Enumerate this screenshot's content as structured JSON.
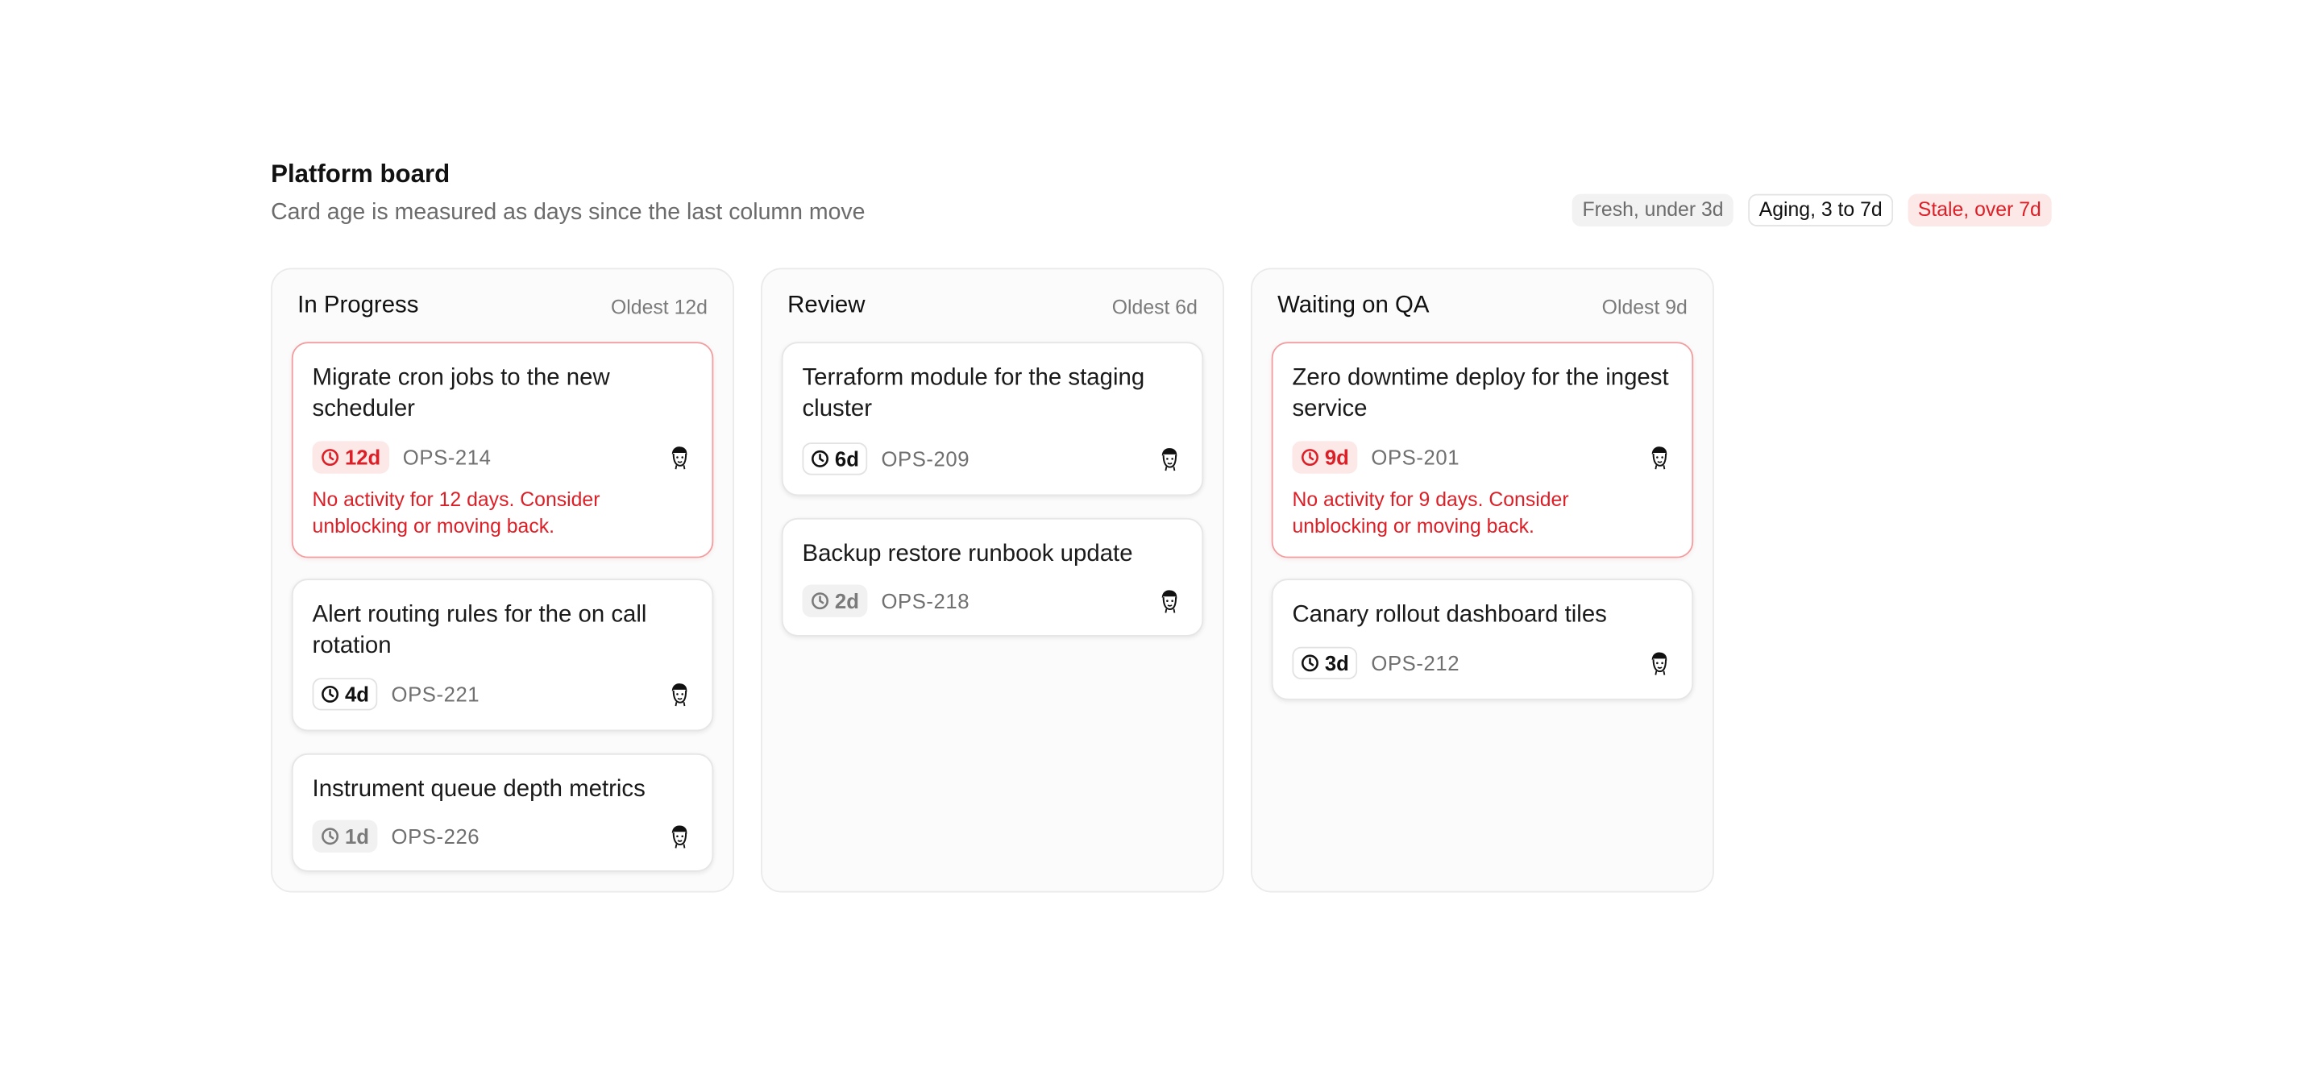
{
  "board": {
    "title": "Platform board",
    "subtitle": "Card age is measured as days since the last column move",
    "legend": {
      "fresh": "Fresh, under 3d",
      "aging": "Aging, 3 to 7d",
      "stale": "Stale, over 7d"
    }
  },
  "colors": {
    "stale": "#dc1f26",
    "stale_bg": "#fde8e8",
    "stale_border": "#f19ea1",
    "muted": "#6b6b6b"
  },
  "columns": [
    {
      "title": "In Progress",
      "oldest": "Oldest 12d",
      "cards": [
        {
          "title": "Migrate cron jobs to the new scheduler",
          "age": "12d",
          "status": "stale",
          "ticket": "OPS-214",
          "warning": "No activity for 12 days. Consider unblocking or moving back.",
          "avatar_icon": "avatar-face-icon"
        },
        {
          "title": "Alert routing rules for the on call rotation",
          "age": "4d",
          "status": "aging",
          "ticket": "OPS-221",
          "avatar_icon": "avatar-face-icon"
        },
        {
          "title": "Instrument queue depth metrics",
          "age": "1d",
          "status": "fresh",
          "ticket": "OPS-226",
          "avatar_icon": "avatar-face-icon"
        }
      ]
    },
    {
      "title": "Review",
      "oldest": "Oldest 6d",
      "cards": [
        {
          "title": "Terraform module for the staging cluster",
          "age": "6d",
          "status": "aging",
          "ticket": "OPS-209",
          "avatar_icon": "avatar-face-icon"
        },
        {
          "title": "Backup restore runbook update",
          "age": "2d",
          "status": "fresh",
          "ticket": "OPS-218",
          "avatar_icon": "avatar-face-icon"
        }
      ]
    },
    {
      "title": "Waiting on QA",
      "oldest": "Oldest 9d",
      "cards": [
        {
          "title": "Zero downtime deploy for the ingest service",
          "age": "9d",
          "status": "stale",
          "ticket": "OPS-201",
          "warning": "No activity for 9 days. Consider unblocking or moving back.",
          "avatar_icon": "avatar-face-icon"
        },
        {
          "title": "Canary rollout dashboard tiles",
          "age": "3d",
          "status": "aging",
          "ticket": "OPS-212",
          "avatar_icon": "avatar-face-icon"
        }
      ]
    }
  ]
}
